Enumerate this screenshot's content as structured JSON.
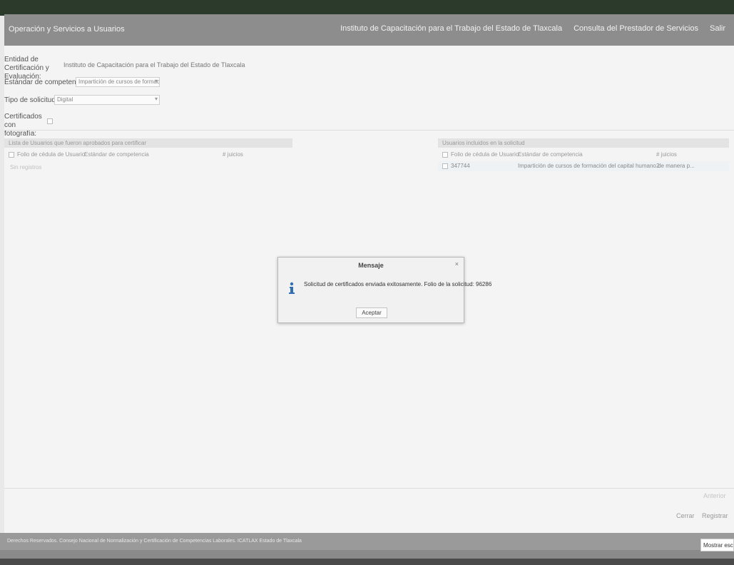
{
  "header": {
    "title": "Operación y Servicios a Usuarios",
    "nav": [
      "Instituto de Capacitación para el Trabajo del Estado de Tlaxcala",
      "Consulta del Prestador de Servicios",
      "Salir"
    ]
  },
  "form": {
    "entity_label": "Entidad de Certificación y Evaluación:",
    "entity_value": "Instituto de Capacitación para el Trabajo del Estado de Tlaxcala",
    "standard_label": "Estándar de competencia:",
    "standard_value": "Impartición de cursos de formación del ca",
    "request_type_label": "Tipo de solicitud:",
    "request_type_value": "Digital",
    "photo_label": "Certificados con fotografía:"
  },
  "left_panel": {
    "title": "Lista de Usuarios que fueron aprobados para certificar",
    "columns": [
      "Folio de cédula de Usuario",
      "Estándar de competencia",
      "# juicios"
    ],
    "empty_text": "Sin registros"
  },
  "right_panel": {
    "title": "Usuarios incluidos en la solicitud",
    "columns": [
      "Folio de cédula de Usuario",
      "Estándar de competencia",
      "# juicios"
    ],
    "rows": [
      {
        "folio": "347744",
        "standard": "Impartición de cursos de formación del capital humano de manera p...",
        "count": "2"
      }
    ]
  },
  "footer_buttons": {
    "prev": "Anterior",
    "close": "Cerrar",
    "send": "Registrar"
  },
  "status_bar": "Derechos Reservados. Consejo Nacional de Normalización y Certificación de Competencias Laborales. ICATLAX Estado de Tlaxcala",
  "tooltip": "Mostrar escritorio",
  "dialog": {
    "title": "Mensaje",
    "close": "×",
    "message": "Solicitud de certificados enviada exitosamente. Folio de la solicitud: 96286",
    "button": "Aceptar"
  }
}
